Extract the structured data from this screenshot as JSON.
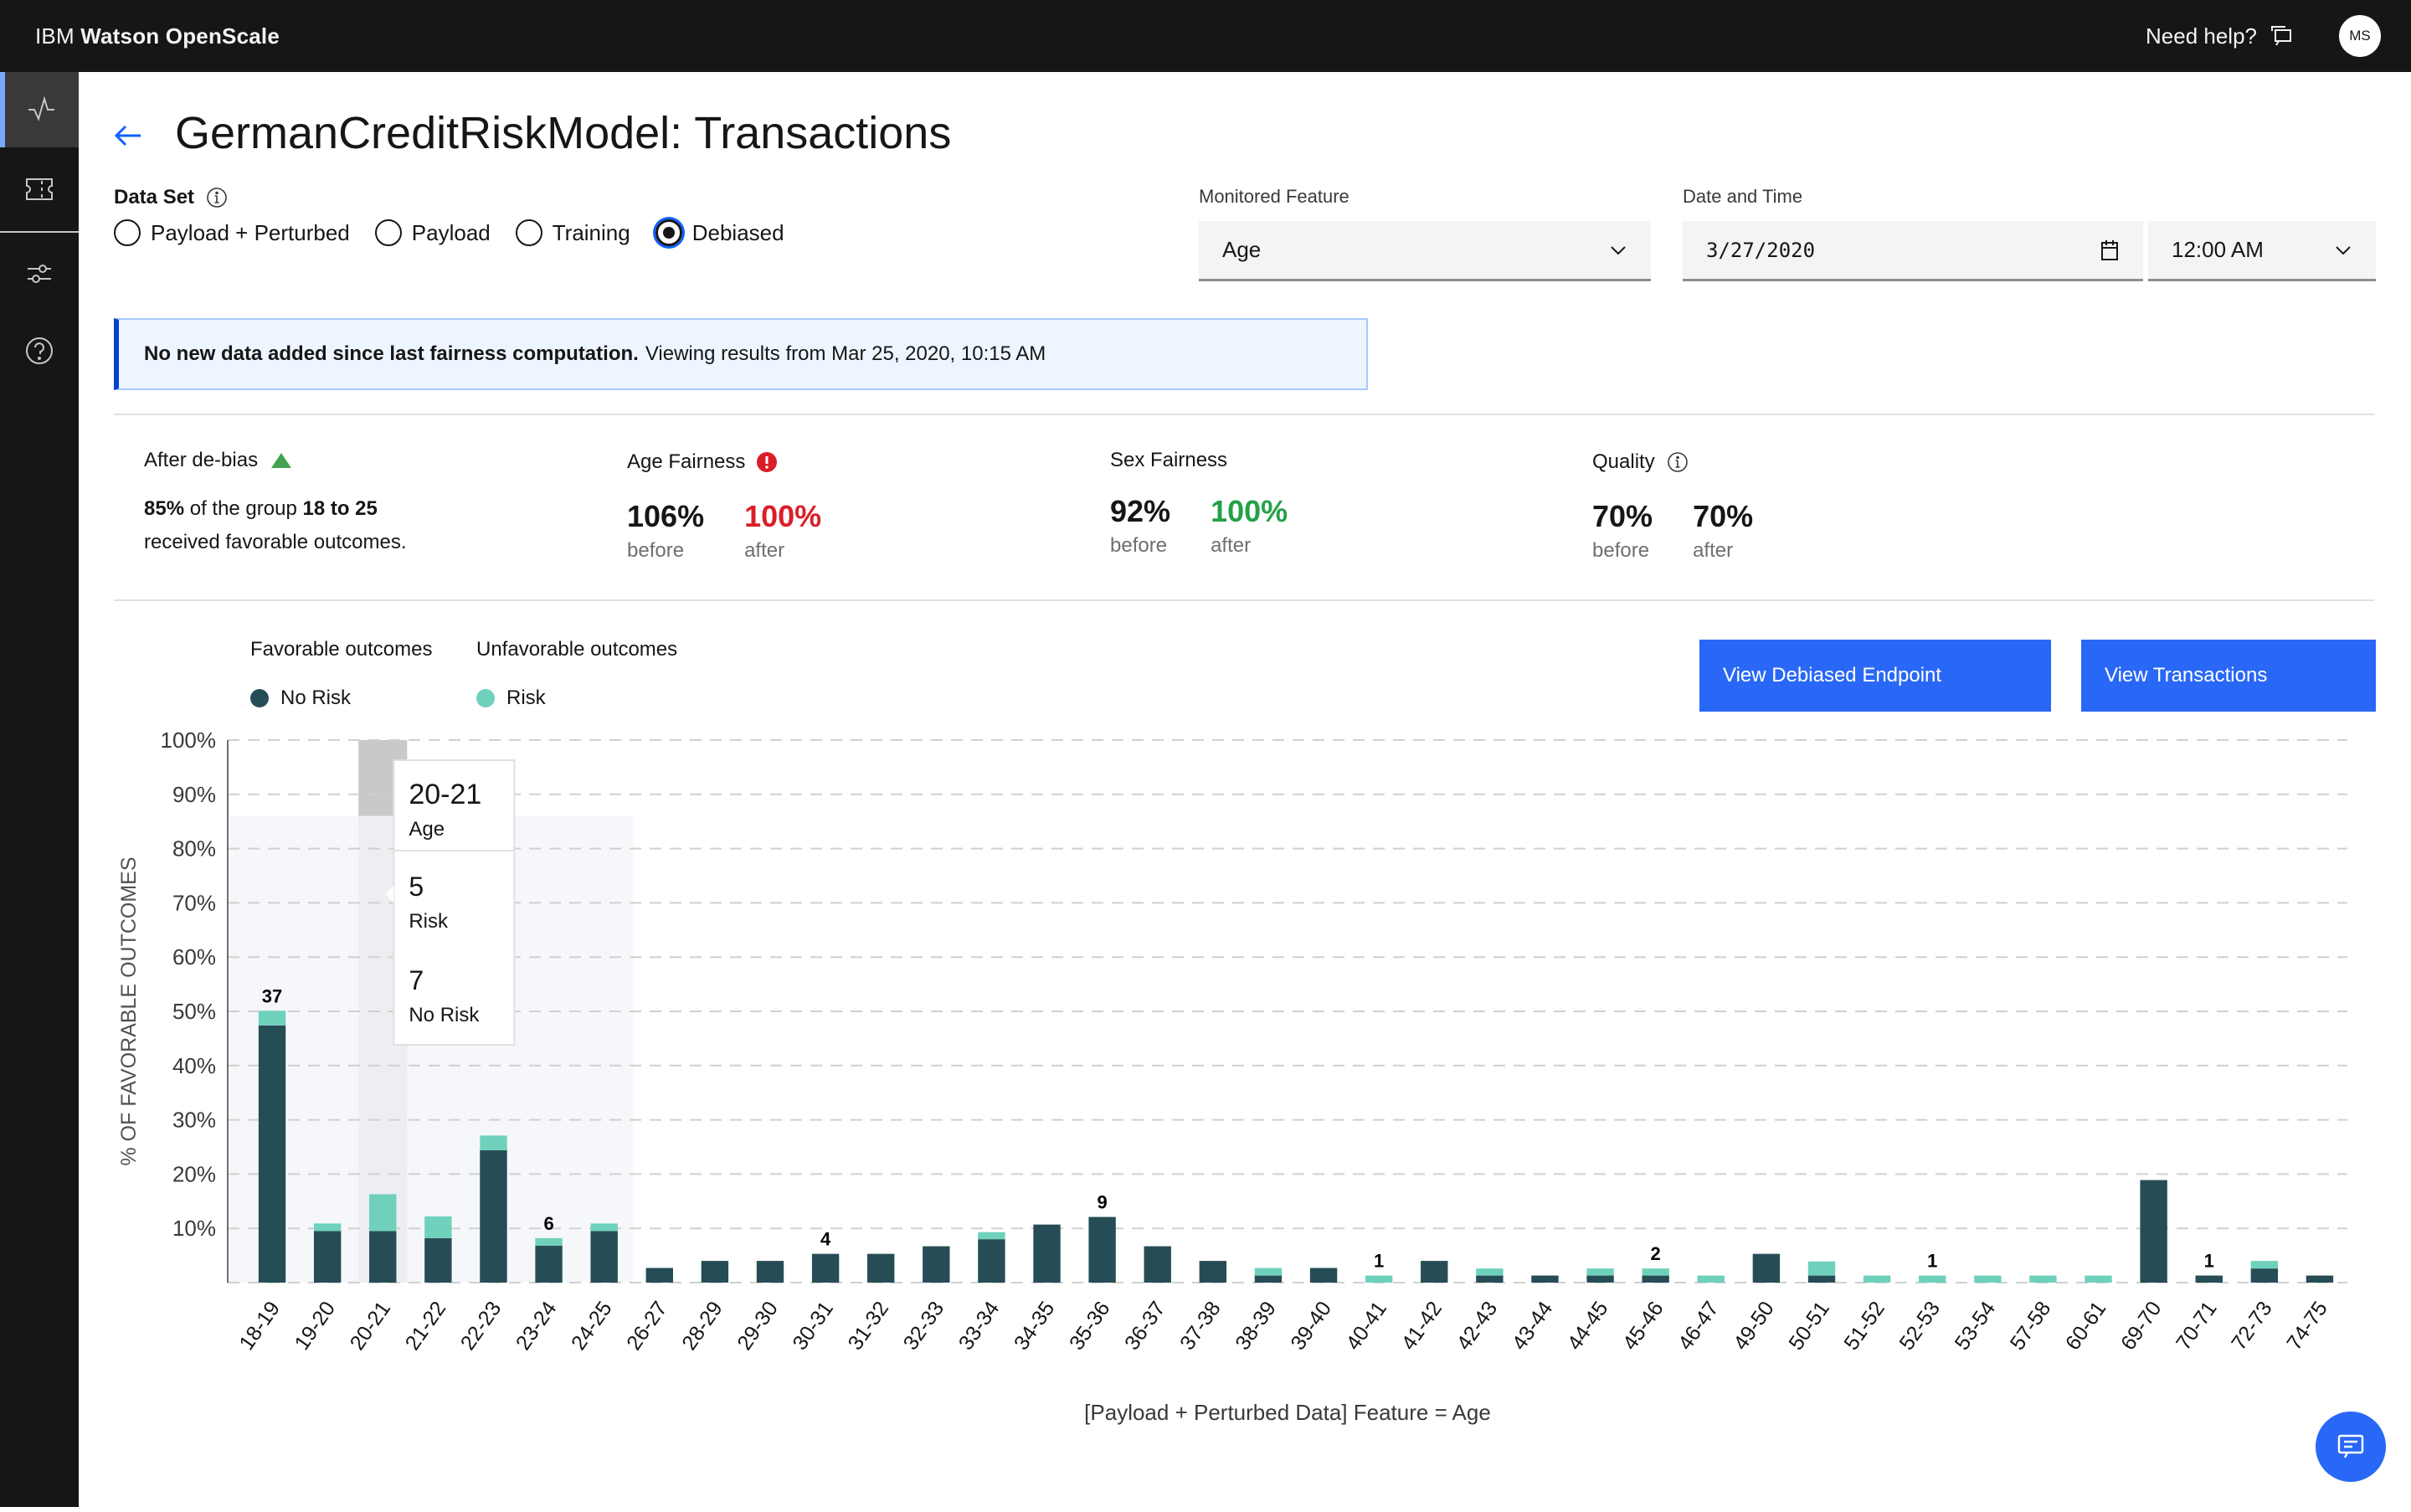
{
  "app": {
    "brand_prefix": "IBM ",
    "brand_name": "Watson OpenScale",
    "help_label": "Need help?",
    "avatar_initials": "MS"
  },
  "sidebar": {
    "items": [
      {
        "name": "monitor",
        "icon": "activity-icon",
        "active": true
      },
      {
        "name": "ticket",
        "icon": "ticket-icon",
        "active": false
      },
      {
        "name": "settings",
        "icon": "sliders-icon",
        "active": false
      },
      {
        "name": "help",
        "icon": "help-icon",
        "active": false
      }
    ]
  },
  "page": {
    "title": "GermanCreditRiskModel: Transactions"
  },
  "dataset": {
    "label": "Data Set",
    "options": [
      "Payload + Perturbed",
      "Payload",
      "Training",
      "Debiased"
    ],
    "selected": "Debiased"
  },
  "monitored_feature": {
    "label": "Monitored Feature",
    "value": "Age"
  },
  "date_time": {
    "label": "Date and Time",
    "date": "3/27/2020",
    "time": "12:00 AM"
  },
  "notice": {
    "bold": "No new data added since last fairness computation.",
    "text": "Viewing results from Mar 25, 2020, 10:15 AM"
  },
  "summary": {
    "debias": {
      "title": "After de-bias",
      "pct": "85%",
      "mid": " of the group ",
      "group": "18 to 25",
      "tail": "received favorable outcomes."
    },
    "age_fairness": {
      "title": "Age Fairness",
      "before": "106%",
      "after": "100%",
      "after_color": "#da1e28",
      "before_label": "before",
      "after_label": "after"
    },
    "sex_fairness": {
      "title": "Sex Fairness",
      "before": "92%",
      "after": "100%",
      "after_color": "#24a148",
      "before_label": "before",
      "after_label": "after"
    },
    "quality": {
      "title": "Quality",
      "before": "70%",
      "after": "70%",
      "after_color": "#161616",
      "before_label": "before",
      "after_label": "after"
    }
  },
  "legend": {
    "favorable_title": "Favorable outcomes",
    "unfavorable_title": "Unfavorable outcomes",
    "favorable_item": "No Risk",
    "unfavorable_item": "Risk",
    "favorable_color": "#264d56",
    "unfavorable_color": "#6fd1bb"
  },
  "buttons": {
    "debiased_endpoint": "View Debiased Endpoint",
    "transactions": "View Transactions"
  },
  "tooltip": {
    "group": "20-21",
    "group_label": "Age",
    "risk_value": "5",
    "risk_label": "Risk",
    "norisk_value": "7",
    "norisk_label": "No Risk"
  },
  "chart_data": {
    "type": "bar",
    "stacked": true,
    "title": "",
    "xlabel": "[Payload + Perturbed Data] Feature = Age",
    "ylabel": "% OF FAVORABLE OUTCOMES",
    "ylim": [
      0,
      100
    ],
    "yticks": [
      "10%",
      "20%",
      "30%",
      "40%",
      "50%",
      "60%",
      "70%",
      "80%",
      "90%",
      "100%"
    ],
    "grid": true,
    "highlight_range": [
      "18-19",
      "24-25"
    ],
    "hovered_category": "20-21",
    "categories": [
      "18-19",
      "19-20",
      "20-21",
      "21-22",
      "22-23",
      "23-24",
      "24-25",
      "26-27",
      "28-29",
      "29-30",
      "30-31",
      "31-32",
      "32-33",
      "33-34",
      "34-35",
      "35-36",
      "36-37",
      "37-38",
      "38-39",
      "39-40",
      "40-41",
      "41-42",
      "42-43",
      "43-44",
      "44-45",
      "45-46",
      "46-47",
      "49-50",
      "50-51",
      "51-52",
      "52-53",
      "53-54",
      "57-58",
      "60-61",
      "69-70",
      "70-71",
      "72-73",
      "74-75"
    ],
    "series": [
      {
        "name": "No Risk",
        "values": [
          47.4,
          9.5,
          9.5,
          8.2,
          24.4,
          6.8,
          9.5,
          2.7,
          4.0,
          4.0,
          5.3,
          5.3,
          6.7,
          8.0,
          10.7,
          12.1,
          6.7,
          4.0,
          1.3,
          2.7,
          0,
          4.0,
          1.3,
          1.3,
          1.3,
          1.3,
          0,
          5.3,
          1.3,
          0,
          0,
          0,
          0,
          0,
          18.9,
          1.3,
          2.6,
          1.3
        ]
      },
      {
        "name": "Risk",
        "values": [
          2.7,
          1.4,
          6.8,
          4.0,
          2.7,
          1.4,
          1.4,
          0,
          0,
          0,
          0,
          0,
          0,
          1.3,
          0,
          0,
          0,
          0,
          1.4,
          0,
          1.3,
          0,
          1.3,
          0,
          1.3,
          1.3,
          1.3,
          0,
          2.6,
          1.3,
          1.3,
          1.3,
          1.3,
          1.3,
          0,
          0,
          1.4,
          0
        ]
      }
    ],
    "data_labels": {
      "18-19": "37",
      "23-24": "6",
      "30-31": "4",
      "35-36": "9",
      "40-41": "1",
      "45-46": "2",
      "52-53": "1",
      "70-71": "1"
    }
  }
}
